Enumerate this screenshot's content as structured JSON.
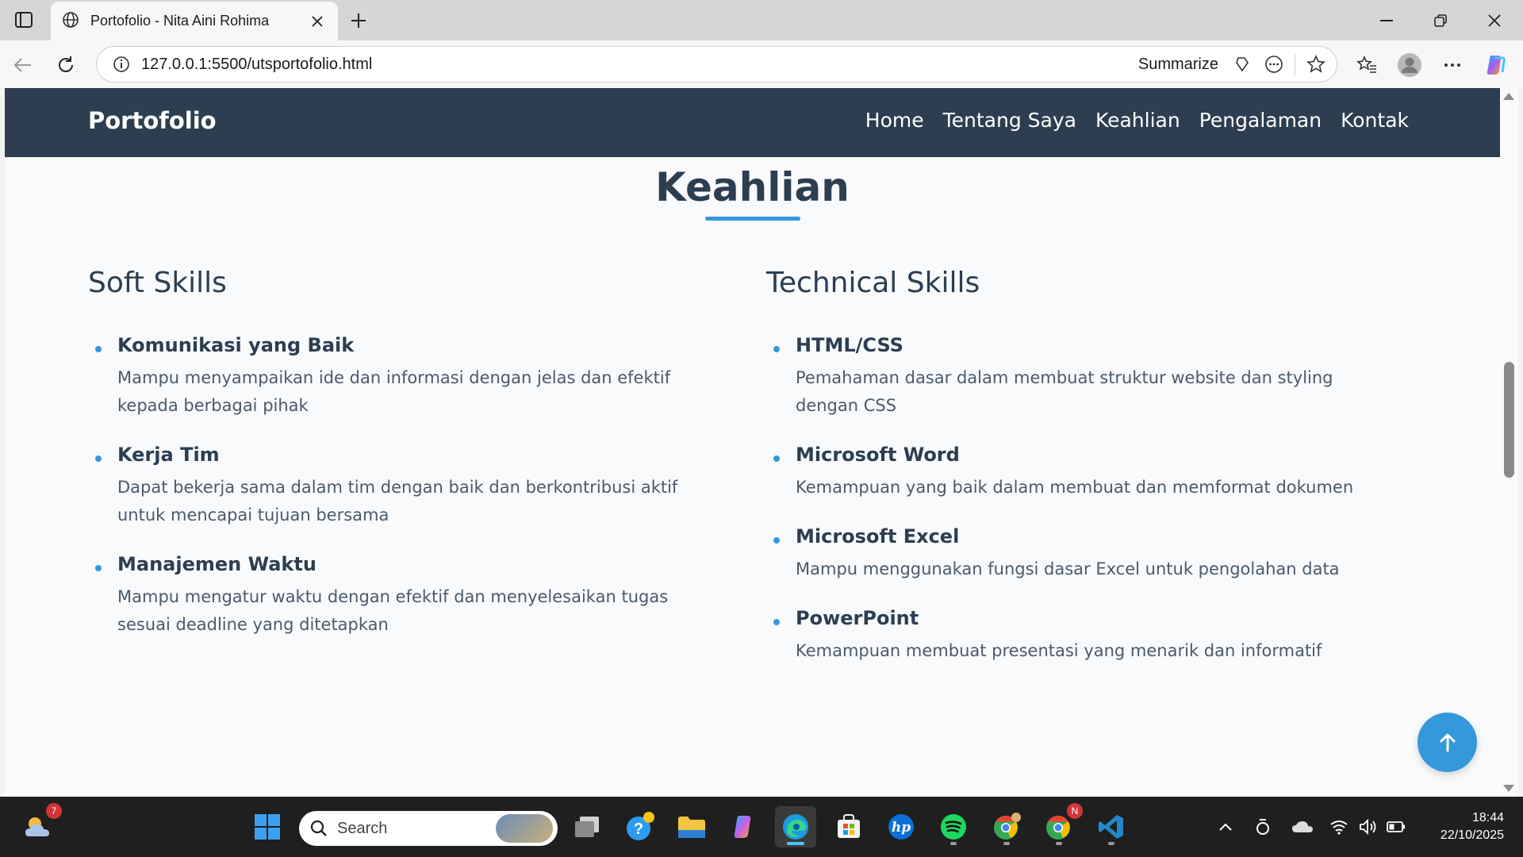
{
  "browser": {
    "tab_title": "Portofolio - Nita Aini Rohima",
    "url": "127.0.0.1:5500/utsportofolio.html",
    "summarize_label": "Summarize"
  },
  "site": {
    "brand": "Portofolio",
    "nav": [
      "Home",
      "Tentang Saya",
      "Keahlian",
      "Pengalaman",
      "Kontak"
    ],
    "section_title": "Keahlian",
    "soft": {
      "heading": "Soft Skills",
      "items": [
        {
          "name": "Komunikasi yang Baik",
          "desc_lines": [
            "Mampu menyampaikan ide dan informasi dengan jelas dan efektif",
            "kepada berbagai pihak"
          ]
        },
        {
          "name": "Kerja Tim",
          "desc_lines": [
            "Dapat bekerja sama dalam tim dengan baik dan berkontribusi aktif",
            "untuk mencapai tujuan bersama"
          ]
        },
        {
          "name": "Manajemen Waktu",
          "desc_lines": [
            "Mampu mengatur waktu dengan efektif dan menyelesaikan tugas",
            "sesuai deadline yang ditetapkan"
          ]
        }
      ]
    },
    "technical": {
      "heading": "Technical Skills",
      "items": [
        {
          "name": "HTML/CSS",
          "desc_lines": [
            "Pemahaman dasar dalam membuat struktur website dan styling",
            "dengan CSS"
          ]
        },
        {
          "name": "Microsoft Word",
          "desc_lines": [
            "Kemampuan yang baik dalam membuat dan memformat dokumen"
          ]
        },
        {
          "name": "Microsoft Excel",
          "desc_lines": [
            "Mampu menggunakan fungsi dasar Excel untuk pengolahan data"
          ]
        },
        {
          "name": "PowerPoint",
          "desc_lines": [
            "Kemampuan membuat presentasi yang menarik dan informatif"
          ]
        }
      ]
    },
    "colors": {
      "nav_bg": "#2c3e50",
      "accent": "#3498db",
      "text": "#2c3e50"
    }
  },
  "taskbar": {
    "search_label": "Search",
    "weather_badge": "7",
    "chrome_badge": "N",
    "time": "18:44",
    "date": "22/10/2025",
    "apps": [
      "weather-icon",
      "start-icon",
      "task-view-icon",
      "help-icon",
      "file-explorer-icon",
      "copilot-icon",
      "edge-icon",
      "store-icon",
      "hp-icon",
      "spotify-icon",
      "chrome-icon",
      "chrome-profile-icon",
      "vscode-icon"
    ]
  }
}
